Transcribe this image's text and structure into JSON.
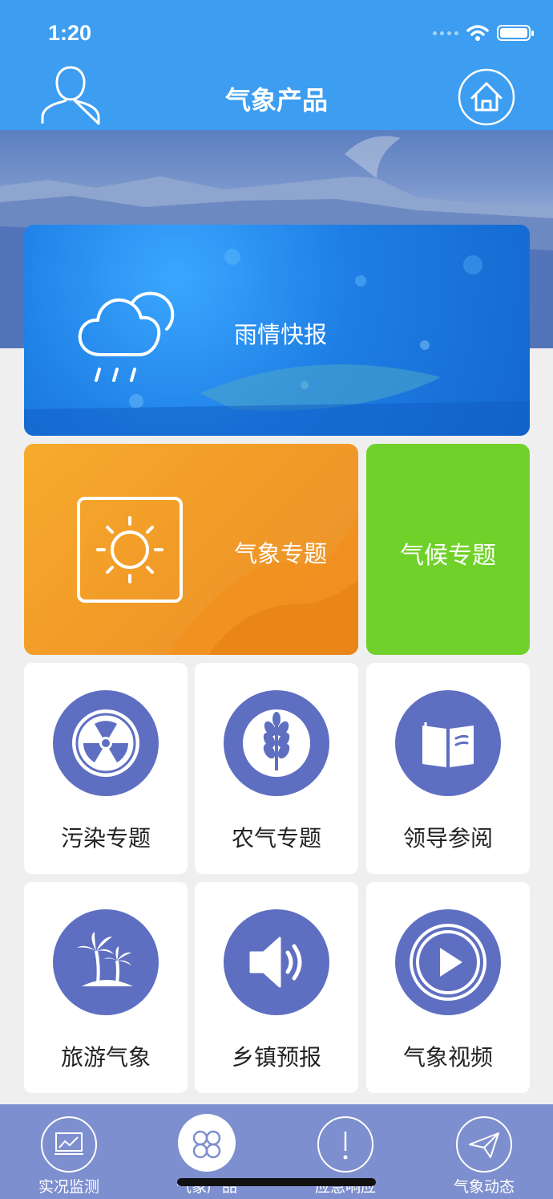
{
  "status_bar": {
    "time": "1:20"
  },
  "header": {
    "title": "气象产品"
  },
  "tiles": {
    "rain": {
      "label": "雨情快报"
    },
    "weather_topic": {
      "label": "气象专题"
    },
    "climate_topic": {
      "label": "气候专题"
    }
  },
  "grid": [
    {
      "label": "污染专题",
      "icon": "radiation-icon"
    },
    {
      "label": "农气专题",
      "icon": "wheat-icon"
    },
    {
      "label": "领导参阅",
      "icon": "open-book-icon"
    },
    {
      "label": "旅游气象",
      "icon": "palm-island-icon"
    },
    {
      "label": "乡镇预报",
      "icon": "speaker-icon"
    },
    {
      "label": "气象视频",
      "icon": "play-icon"
    }
  ],
  "tabbar": [
    {
      "label": "实况监测",
      "icon": "monitor-chart-icon"
    },
    {
      "label": "气象产品",
      "icon": "grid-clover-icon",
      "active": true
    },
    {
      "label": "应急响应",
      "icon": "alert-icon"
    },
    {
      "label": "气象动态",
      "icon": "paper-plane-icon"
    }
  ],
  "colors": {
    "header": "#3d9df0",
    "icon_circle": "#5e6fc2",
    "climate_tile": "#6fd129",
    "tabbar": "#7e8fcf"
  }
}
